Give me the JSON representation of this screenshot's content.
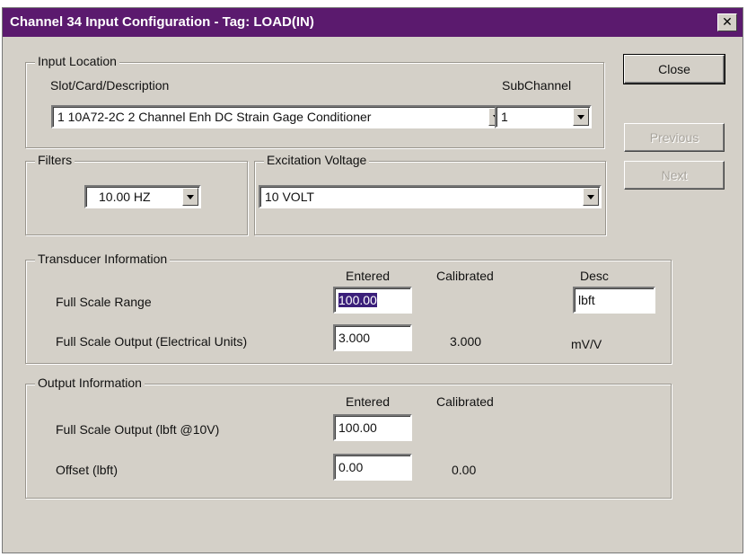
{
  "window": {
    "title": "Channel 34 Input Configuration - Tag: LOAD(IN)",
    "close_glyph": "✕"
  },
  "buttons": {
    "close": "Close",
    "previous": "Previous",
    "next": "Next"
  },
  "input_location": {
    "legend": "Input Location",
    "slot_label": "Slot/Card/Description",
    "slot_value": "1  10A72-2C 2 Channel Enh DC Strain Gage Conditioner",
    "subchannel_label": "SubChannel",
    "subchannel_value": "1"
  },
  "filters": {
    "legend": "Filters",
    "value": "10.00 HZ"
  },
  "excitation": {
    "legend": "Excitation Voltage",
    "value": "10 VOLT"
  },
  "transducer": {
    "legend": "Transducer Information",
    "col_entered": "Entered",
    "col_calibrated": "Calibrated",
    "col_desc": "Desc",
    "fsr_label": "Full Scale Range",
    "fsr_entered": "100.00",
    "fsr_desc": "lbft",
    "fso_label": "Full Scale Output (Electrical Units)",
    "fso_entered": "3.000",
    "fso_calibrated": "3.000",
    "fso_units": "mV/V"
  },
  "output": {
    "legend": "Output Information",
    "col_entered": "Entered",
    "col_calibrated": "Calibrated",
    "fso_label": "Full Scale Output (lbft @10V)",
    "fso_entered": "100.00",
    "offset_label": "Offset (lbft)",
    "offset_entered": "0.00",
    "offset_calibrated": "0.00"
  }
}
